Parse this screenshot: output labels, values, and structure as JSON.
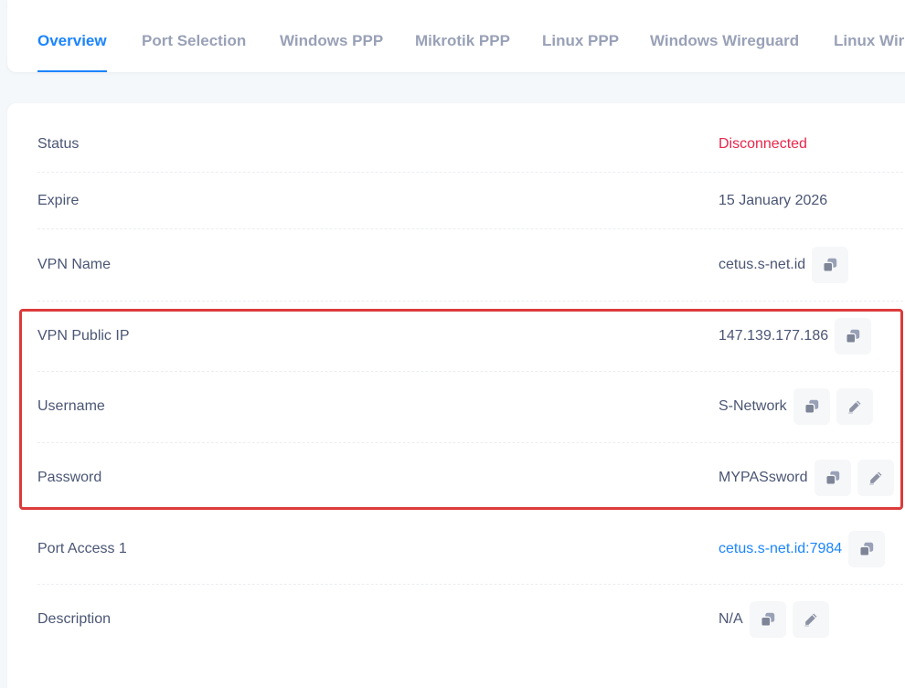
{
  "tabs": [
    {
      "label": "Overview",
      "active": true
    },
    {
      "label": "Port Selection",
      "active": false
    },
    {
      "label": "Windows PPP",
      "active": false
    },
    {
      "label": "Mikrotik PPP",
      "active": false
    },
    {
      "label": "Linux PPP",
      "active": false
    },
    {
      "label": "Windows Wireguard",
      "active": false
    },
    {
      "label": "Linux Wireguard",
      "active": false
    }
  ],
  "details": {
    "status": {
      "label": "Status",
      "value": "Disconnected"
    },
    "expire": {
      "label": "Expire",
      "value": "15 January 2026"
    },
    "vpn_name": {
      "label": "VPN Name",
      "value": "cetus.s-net.id"
    },
    "vpn_public_ip": {
      "label": "VPN Public IP",
      "value": "147.139.177.186"
    },
    "username": {
      "label": "Username",
      "value": "S-Network"
    },
    "password": {
      "label": "Password",
      "value": "MYPASsword"
    },
    "port_access_1": {
      "label": "Port Access 1",
      "value": "cetus.s-net.id:7984"
    },
    "description": {
      "label": "Description",
      "value": "N/A"
    }
  },
  "icons": {
    "copy": "copy-icon",
    "edit": "pencil-icon"
  },
  "colors": {
    "accent": "#1b84ff",
    "danger": "#e8254b",
    "highlight": "#dc3b3b",
    "icon": "#8c92a4"
  }
}
